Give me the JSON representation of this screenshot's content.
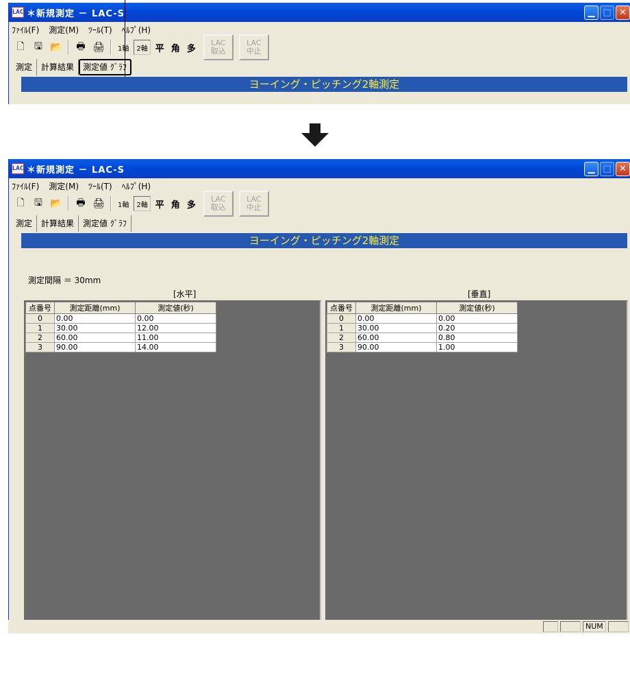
{
  "window": {
    "app_icon": "LAC",
    "title": "＊新規測定 － LAC-S",
    "controls": [
      "minimize",
      "maximize",
      "close"
    ]
  },
  "menu": {
    "items": [
      "ﾌｧｲﾙ(F)",
      "測定(M)",
      "ﾂｰﾙ(T)",
      "ﾍﾙﾌﾟ(H)"
    ]
  },
  "toolbar": {
    "icons": [
      "new-icon",
      "save-icon",
      "open-icon",
      "print-preview-icon",
      "print-icon"
    ],
    "mode_1axis": "1軸",
    "mode_2axis": "2軸",
    "flat": "平",
    "angle": "角",
    "multi": "多",
    "lac_import": [
      "LAC",
      "取込"
    ],
    "lac_stop": [
      "LAC",
      "中止"
    ]
  },
  "tabs": [
    "測定",
    "計算結果",
    "測定値 ｸﾞﾗﾌ"
  ],
  "banner": "ヨーイング・ピッチング2軸測定",
  "interval_text": "測定間隔 ＝ 30mm",
  "tables": {
    "columns": [
      "点番号",
      "測定距離(mm)",
      "測定値(秒)"
    ],
    "horizontal": {
      "label": "[水平]",
      "rows": [
        [
          "0",
          "0.00",
          "0.00"
        ],
        [
          "1",
          "30.00",
          "12.00"
        ],
        [
          "2",
          "60.00",
          "11.00"
        ],
        [
          "3",
          "90.00",
          "14.00"
        ]
      ]
    },
    "vertical": {
      "label": "[垂直]",
      "rows": [
        [
          "0",
          "0.00",
          "0.00"
        ],
        [
          "1",
          "30.00",
          "0.20"
        ],
        [
          "2",
          "60.00",
          "0.80"
        ],
        [
          "3",
          "90.00",
          "1.00"
        ]
      ]
    }
  },
  "status": [
    "",
    "",
    "NUM",
    ""
  ]
}
